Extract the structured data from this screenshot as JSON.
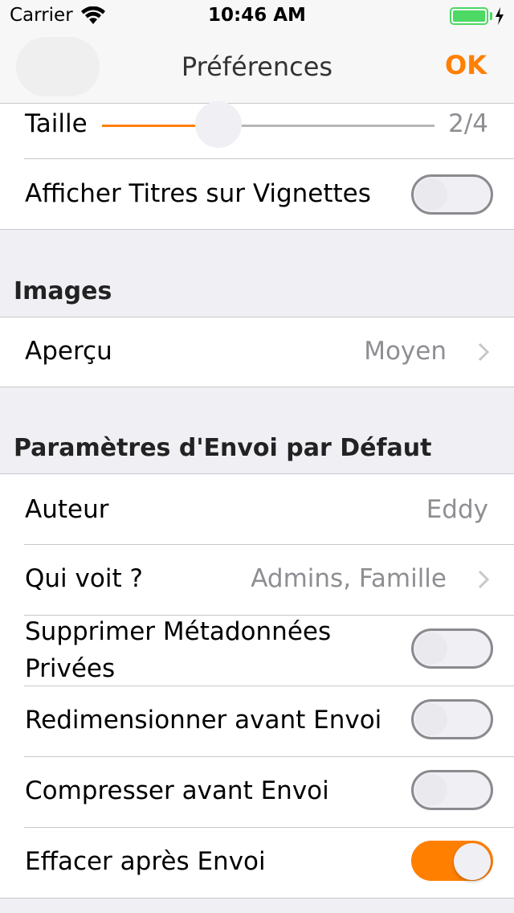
{
  "status_bar": {
    "carrier": "Carrier",
    "time": "10:46 AM"
  },
  "nav": {
    "title": "Préférences",
    "done": "OK"
  },
  "display": {
    "size_label": "Taille",
    "size_value": "2/4",
    "size_level": 0.35,
    "titles_label": "Afficher Titres sur Vignettes",
    "titles_on": false
  },
  "images": {
    "header": "Images",
    "preview_label": "Aperçu",
    "preview_value": "Moyen"
  },
  "upload": {
    "header": "Paramètres d'Envoi par Défaut",
    "author_label": "Auteur",
    "author_value": "Eddy",
    "who_label": "Qui voit ?",
    "who_value": "Admins, Famille",
    "strip_label_line1": "Supprimer Métadonnées",
    "strip_label_line2": "Privées",
    "strip_on": false,
    "resize_label": "Redimensionner avant Envoi",
    "resize_on": false,
    "compress_label": "Compresser avant Envoi",
    "compress_on": false,
    "delete_label": "Effacer après Envoi",
    "delete_on": true
  },
  "colors": {
    "accent": "#ff7f00",
    "battery": "#4cd964",
    "secondary_text": "#8e8e93"
  }
}
